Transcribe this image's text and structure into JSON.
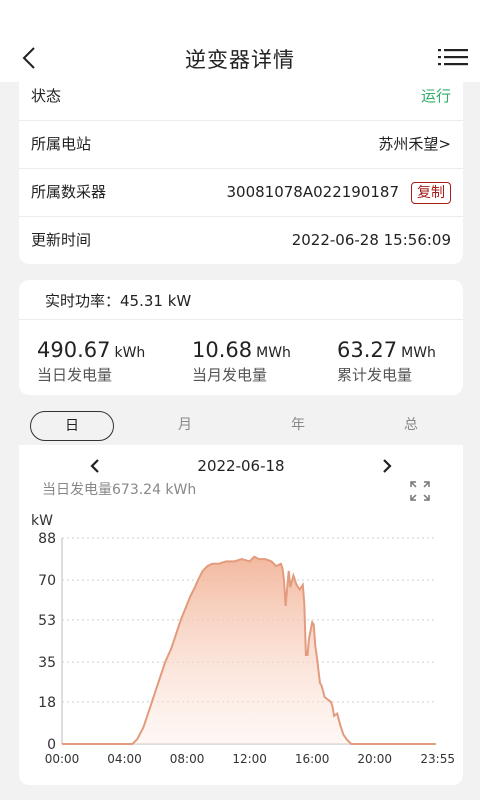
{
  "header": {
    "title": "逆变器详情"
  },
  "info": {
    "status_label": "状态",
    "status_value": "运行",
    "station_label": "所属电站",
    "station_value": "苏州禾望>",
    "collector_label": "所属数采器",
    "collector_value": "30081078A022190187",
    "copy_label": "复制",
    "update_label": "更新时间",
    "update_value": "2022-06-28 15:56:09"
  },
  "power": {
    "realtime": "实时功率：45.31 kW",
    "daily": {
      "value": "490.67",
      "unit": "kWh",
      "label": "当日发电量"
    },
    "monthly": {
      "value": "10.68",
      "unit": "MWh",
      "label": "当月发电量"
    },
    "total": {
      "value": "63.27",
      "unit": "MWh",
      "label": "累计发电量"
    }
  },
  "tabs": [
    "日",
    "月",
    "年",
    "总"
  ],
  "chart": {
    "date": "2022-06-18",
    "day_total": "当日发电量673.24 kWh"
  },
  "colors": {
    "accent_line": "#e39b7d",
    "fill_top": "#f2b59a",
    "status_green": "#2fae6a",
    "copy_red": "#a61d1d"
  },
  "chart_data": {
    "type": "area",
    "ylabel": "kW",
    "yticks": [
      0,
      18,
      35,
      53,
      70,
      88
    ],
    "ylim": [
      0,
      88
    ],
    "xticks": [
      "00:00",
      "04:00",
      "08:00",
      "12:00",
      "16:00",
      "20:00",
      "23:55"
    ],
    "grid": true,
    "x": [
      0,
      4.5,
      4.8,
      5.2,
      5.6,
      6.0,
      6.3,
      6.6,
      7.0,
      7.3,
      7.6,
      7.9,
      8.2,
      8.5,
      8.7,
      9.0,
      9.3,
      9.6,
      9.8,
      10.0,
      10.5,
      11.0,
      11.5,
      12.0,
      12.3,
      12.6,
      13.0,
      13.4,
      13.7,
      14.0,
      14.1,
      14.2,
      14.3,
      14.5,
      14.6,
      14.8,
      15.0,
      15.2,
      15.4,
      15.5,
      15.6,
      15.7,
      15.8,
      16.0,
      16.1,
      16.2,
      16.3,
      16.5,
      16.6,
      16.8,
      17.0,
      17.2,
      17.3,
      17.4,
      17.6,
      17.8,
      18.0,
      18.2,
      18.5,
      19.0,
      23.9
    ],
    "y": [
      0,
      0,
      2,
      7,
      15,
      23,
      29,
      35,
      41,
      47,
      53,
      58,
      63,
      67,
      70,
      74,
      76,
      77,
      77,
      77,
      78,
      78,
      79,
      78,
      80,
      79,
      79,
      78,
      76,
      77,
      75,
      70,
      59,
      74,
      67,
      72,
      68,
      66,
      68,
      60,
      38,
      38,
      45,
      52,
      51,
      42,
      37,
      26,
      25,
      20,
      19,
      18,
      16,
      12,
      13,
      8,
      4,
      2,
      0,
      0,
      0
    ]
  }
}
